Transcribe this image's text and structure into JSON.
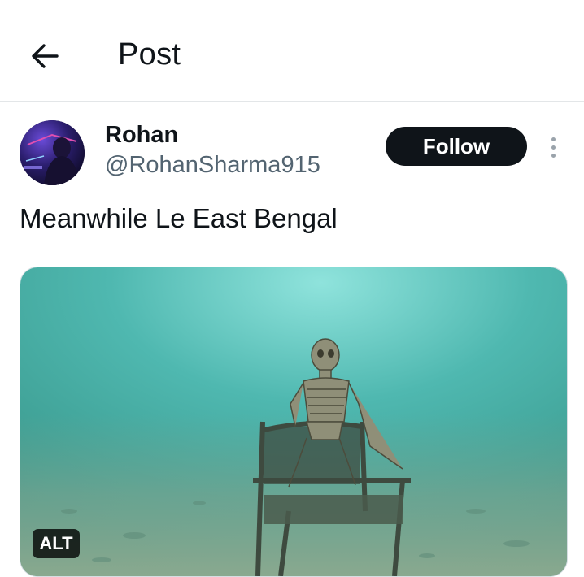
{
  "header": {
    "title": "Post",
    "back_icon": "arrow-left-icon"
  },
  "post": {
    "author_name": "Rohan",
    "author_handle": "@RohanSharma915",
    "follow_label": "Follow",
    "text": "Meanwhile Le East Bengal",
    "media": {
      "alt_label": "ALT",
      "subject": "skeleton seated in a chair underwater"
    }
  },
  "colors": {
    "text": "#0f1419",
    "secondary": "#536471",
    "follow_bg": "#0f1419",
    "water": "#4fb8b0"
  }
}
